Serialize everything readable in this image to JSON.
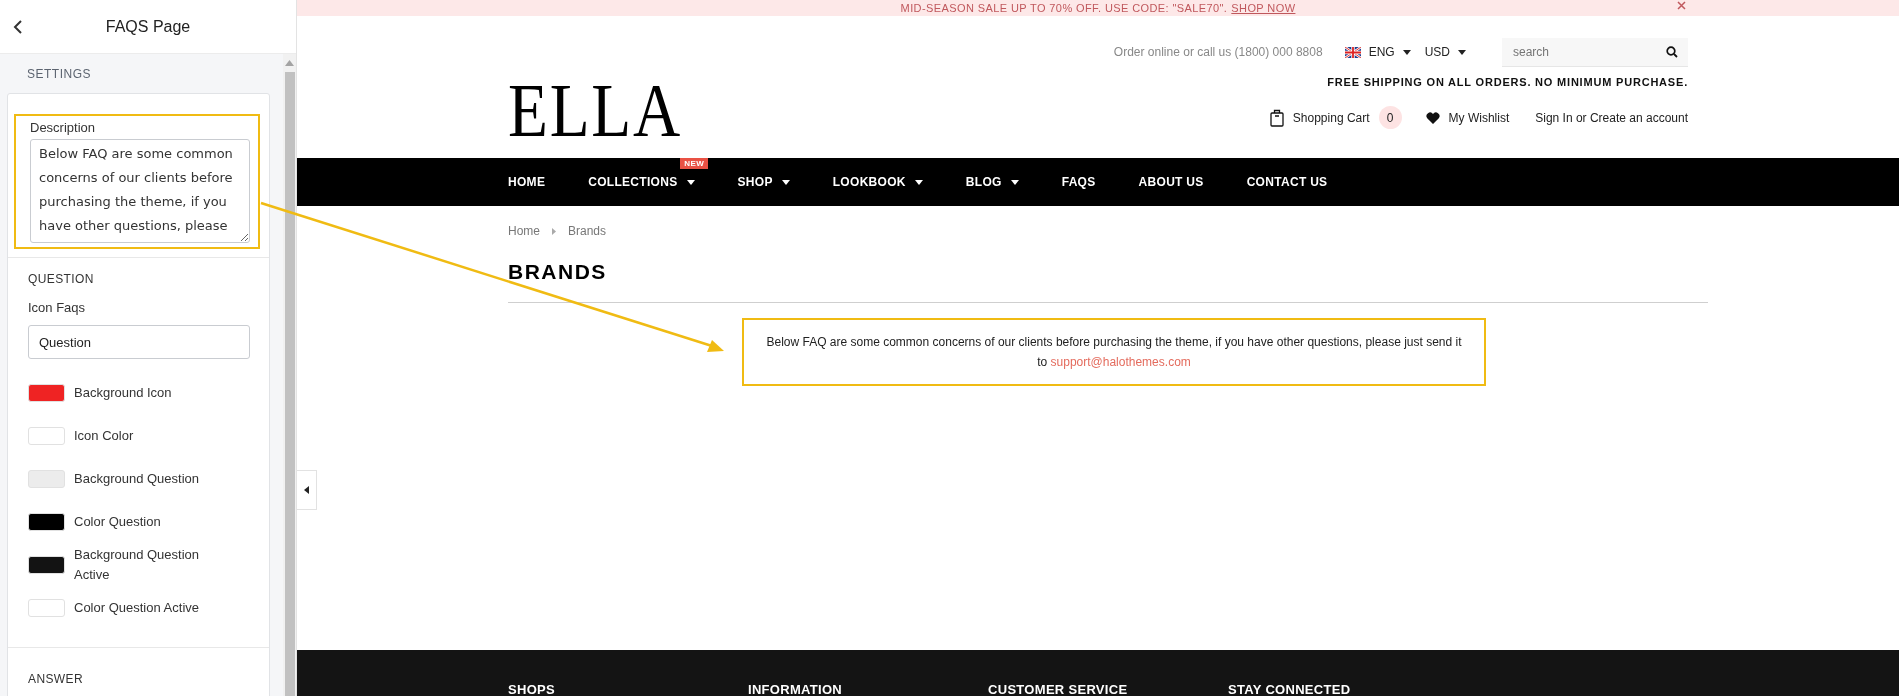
{
  "panel": {
    "title": "FAQS Page",
    "section_label": "SETTINGS",
    "description": {
      "label": "Description",
      "value": "Below FAQ are some common concerns of our clients before purchasing the theme, if you have other questions, please"
    },
    "question": {
      "heading": "QUESTION",
      "icon_label": "Icon Faqs",
      "icon_value": "Question",
      "colors": [
        {
          "label": "Background Icon",
          "color": "#ef2323"
        },
        {
          "label": "Icon Color",
          "color": "#ffffff"
        },
        {
          "label": "Background Question",
          "color": "#ececec"
        },
        {
          "label": "Color Question",
          "color": "#000000"
        },
        {
          "label": "Background Question Active",
          "color": "#131313"
        },
        {
          "label": "Color Question Active",
          "color": "#ffffff"
        }
      ]
    },
    "answer_heading": "ANSWER"
  },
  "store": {
    "banner": {
      "text": "MID-SEASON SALE UP TO 70% OFF. USE CODE: \"SALE70\".",
      "link": "SHOP NOW"
    },
    "contact": "Order online or call us (1800) 000 8808",
    "language": "ENG",
    "currency": "USD",
    "search": {
      "placeholder": "search"
    },
    "logo": "ELLA",
    "shipping_note": "FREE SHIPPING ON ALL ORDERS. NO MINIMUM PURCHASE.",
    "cart": {
      "label": "Shopping Cart",
      "count": "0"
    },
    "wishlist": "My Wishlist",
    "account": "Sign In or Create an account",
    "nav": [
      {
        "label": "HOME",
        "dropdown": false
      },
      {
        "label": "COLLECTIONS",
        "dropdown": true,
        "badge": "NEW"
      },
      {
        "label": "SHOP",
        "dropdown": true
      },
      {
        "label": "LOOKBOOK",
        "dropdown": true
      },
      {
        "label": "BLOG",
        "dropdown": true
      },
      {
        "label": "FAQS",
        "dropdown": false
      },
      {
        "label": "ABOUT US",
        "dropdown": false
      },
      {
        "label": "CONTACT US",
        "dropdown": false
      }
    ],
    "breadcrumb": [
      "Home",
      "Brands"
    ],
    "page_title": "BRANDS",
    "intro": {
      "text": "Below FAQ are some common concerns of our clients before purchasing the theme, if you have other questions, please just send it to",
      "email": "support@halothemes.com"
    },
    "footer_headings": [
      "SHOPS",
      "INFORMATION",
      "CUSTOMER SERVICE",
      "STAY CONNECTED"
    ]
  }
}
